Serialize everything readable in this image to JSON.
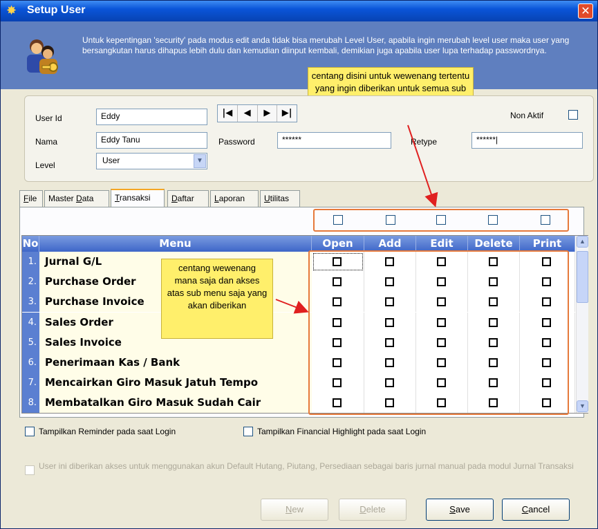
{
  "window": {
    "title": "Setup User",
    "close_label": "✕"
  },
  "info": {
    "message": "Untuk kepentingan 'security' pada modus edit anda tidak bisa merubah Level User, apabila ingin merubah level user maka user yang bersangkutan harus dihapus lebih dulu  dan kemudian diinput kembali, demikian juga apabila user lupa terhadap passwordnya."
  },
  "callouts": {
    "top": "centang disini untuk wewenang tertentu yang ingin diberikan untuk semua sub menu yang ada pada tab ini",
    "left": "centang wewenang mana saja dan akses atas sub menu saja yang akan diberikan"
  },
  "form": {
    "user_id_label": "User Id",
    "user_id_value": "Eddy",
    "nama_label": "Nama",
    "nama_value": "Eddy Tanu",
    "level_label": "Level",
    "level_value": "User",
    "password_label": "Password",
    "password_value": "******",
    "retype_label": "Retype",
    "retype_value": "******|",
    "non_aktif_label": "Non Aktif",
    "nav": [
      "|◀",
      "◀",
      "▶",
      "▶|"
    ]
  },
  "tabs": [
    {
      "label": "File",
      "u": "F",
      "rest": "ile"
    },
    {
      "label": "Master Data",
      "pre": "Master ",
      "u": "D",
      "rest": "ata"
    },
    {
      "label": "Transaksi",
      "u": "T",
      "rest": "ransaksi",
      "active": true
    },
    {
      "label": "Daftar",
      "u": "D",
      "rest": "aftar"
    },
    {
      "label": "Laporan",
      "u": "L",
      "rest": "aporan"
    },
    {
      "label": "Utilitas",
      "u": "U",
      "rest": "tilitas"
    }
  ],
  "grid": {
    "headers": {
      "no": "No",
      "menu": "Menu",
      "open": "Open",
      "add": "Add",
      "edit": "Edit",
      "delete": "Delete",
      "print": "Print"
    },
    "rows": [
      {
        "no": "1.",
        "menu": "Jurnal G/L"
      },
      {
        "no": "2.",
        "menu": "Purchase Order"
      },
      {
        "no": "3.",
        "menu": "Purchase Invoice"
      },
      {
        "no": "4.",
        "menu": "Sales Order"
      },
      {
        "no": "5.",
        "menu": "Sales Invoice"
      },
      {
        "no": "6.",
        "menu": "Penerimaan Kas / Bank"
      },
      {
        "no": "7.",
        "menu": "Mencairkan Giro Masuk Jatuh Tempo"
      },
      {
        "no": "8.",
        "menu": "Membatalkan Giro Masuk Sudah Cair"
      }
    ]
  },
  "options": {
    "reminder": "Tampilkan Reminder pada saat Login",
    "financial": "Tampilkan Financial Highlight pada saat Login",
    "default_akun": "User ini diberikan akses untuk menggunakan akun Default Hutang, Piutang, Persediaan sebagai baris jurnal manual pada modul Jurnal Transaksi"
  },
  "buttons": {
    "new": {
      "u": "N",
      "rest": "ew"
    },
    "delete": {
      "u": "D",
      "rest": "elete"
    },
    "save": {
      "u": "S",
      "rest": "ave"
    },
    "cancel": {
      "u": "C",
      "rest": "ancel"
    }
  },
  "colors": {
    "title_bar": "#0a55d8",
    "info_bg": "#5f7fbf",
    "callout": "#ffef6b",
    "highlight_border": "#e6793a",
    "arrow": "#e02020"
  }
}
